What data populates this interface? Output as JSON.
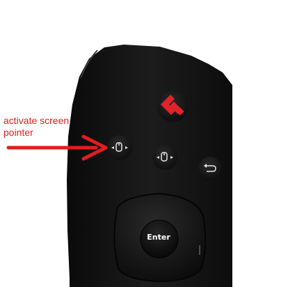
{
  "annotation": {
    "line1": "activate screen",
    "line2": "pointer"
  },
  "remote": {
    "enter_label": "Enter",
    "buttons": [
      "home-button",
      "pointer-button",
      "pointer-alt-button",
      "back-button",
      "dpad",
      "enter-button"
    ]
  },
  "colors": {
    "annotation": "#e21d1d",
    "remote_body": "#141414",
    "logo": "#e0232b"
  },
  "icons": {
    "home": "remote-logo-icon",
    "pointer": "screen-pointer-icon",
    "back": "back-arrow-icon",
    "arrow": "annotation-arrow-icon"
  }
}
